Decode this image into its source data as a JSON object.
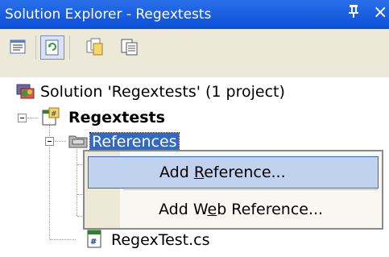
{
  "window": {
    "title": "Solution Explorer - Regextests",
    "pin_glyph": "И",
    "close_glyph": "×"
  },
  "toolbar": {
    "buttons": [
      {
        "name": "properties-icon"
      },
      {
        "name": "refresh-icon"
      },
      {
        "name": "show-all-files-icon"
      },
      {
        "name": "view-code-icon"
      }
    ]
  },
  "tree": {
    "solution_label": "Solution 'Regextests' (1 project)",
    "project_label": "Regextests",
    "references_label": "References",
    "file_label": "RegexTest.cs"
  },
  "context_menu": {
    "add_reference_prefix": "Add ",
    "add_reference_accel": "R",
    "add_reference_suffix": "eference...",
    "add_web_reference_prefix": "Add W",
    "add_web_reference_accel": "e",
    "add_web_reference_suffix": "b Reference..."
  },
  "colors": {
    "title_bar": "#0a4fd8",
    "toolbar_bg": "#ece9d8",
    "selection": "#316ac5",
    "menu_highlight": "#c1d2ee"
  }
}
